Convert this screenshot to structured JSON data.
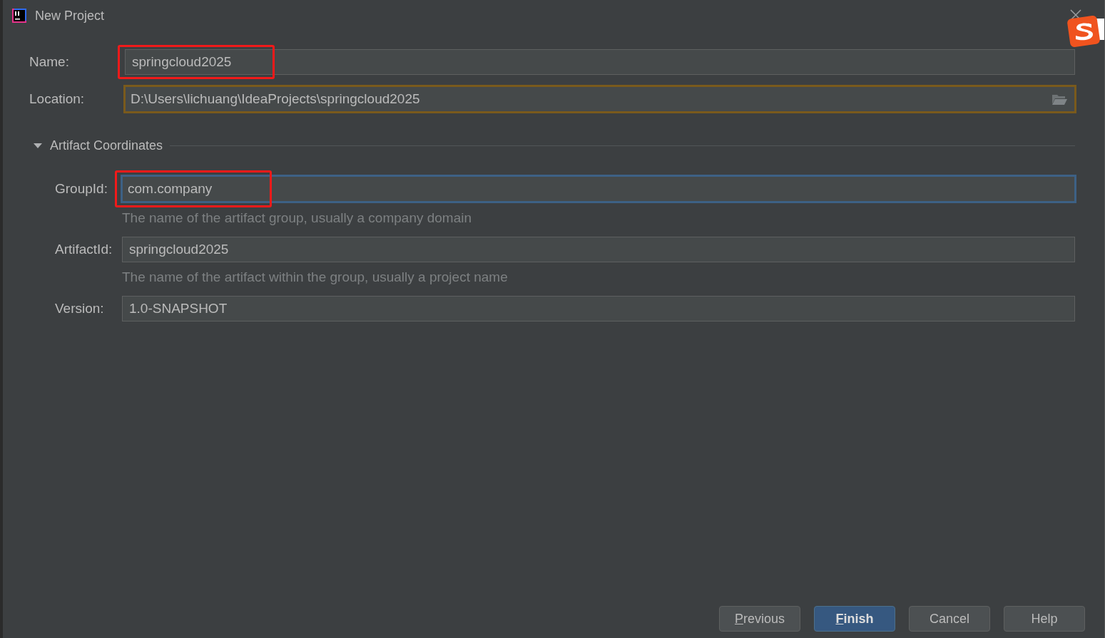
{
  "window": {
    "title": "New Project"
  },
  "fields": [
    {
      "kind": "text",
      "label": "Name:",
      "value": "springcloud2025",
      "focused": false,
      "warning": false,
      "annotated": true
    },
    {
      "kind": "folder",
      "label": "Location:",
      "value": "D:\\Users\\lichuang\\IdeaProjects\\springcloud2025",
      "focused": false,
      "warning": true,
      "annotated": false
    }
  ],
  "section": {
    "title": "Artifact Coordinates",
    "expanded": true
  },
  "artifact_fields": [
    {
      "label": "GroupId:",
      "value": "com.company",
      "hint": "The name of the artifact group, usually a company domain",
      "focused": true,
      "warning": false,
      "annotated": true
    },
    {
      "label": "ArtifactId:",
      "value": "springcloud2025",
      "hint": "The name of the artifact within the group, usually a project name",
      "focused": false,
      "warning": false,
      "annotated": false
    },
    {
      "label": "Version:",
      "value": "1.0-SNAPSHOT",
      "focused": false,
      "warning": false,
      "annotated": false
    }
  ],
  "buttons": [
    {
      "label": "Previous",
      "default": false,
      "mnemonic": true
    },
    {
      "label": "Finish",
      "default": true,
      "mnemonic": true
    },
    {
      "label": "Cancel",
      "default": false,
      "mnemonic": false
    },
    {
      "label": "Help",
      "default": false,
      "mnemonic": false
    }
  ]
}
